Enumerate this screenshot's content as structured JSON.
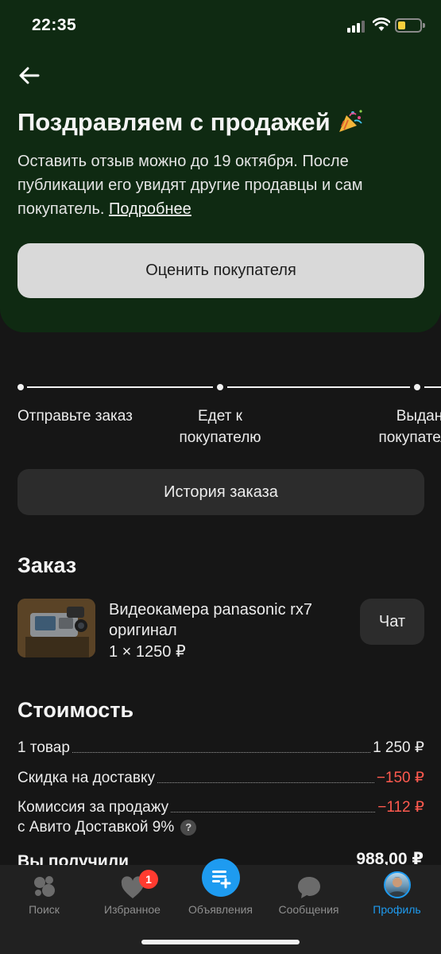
{
  "status_bar": {
    "time": "22:35"
  },
  "hero": {
    "title": "Поздравляем с продажей",
    "description": "Оставить отзыв можно до 19 октября. После публикации его увидят другие продавцы и сам покупатель.",
    "link": "Подробнее",
    "rate_button": "Оценить покупателя"
  },
  "timeline": {
    "steps": [
      {
        "label": "Отправьте заказ"
      },
      {
        "label_line1": "Едет к",
        "label_line2": "покупателю"
      },
      {
        "label_line1": "Выдан",
        "label_line2": "покупателю"
      }
    ]
  },
  "history_button": "История заказа",
  "order": {
    "title": "Заказ",
    "product_name": "Видеокамера panasonic rx7 оригинал",
    "product_qty": "1 × 1250 ₽",
    "chat_button": "Чат"
  },
  "cost": {
    "title": "Стоимость",
    "rows": [
      {
        "label": "1 товар",
        "value": "1 250 ₽"
      },
      {
        "label": "Скидка на доставку",
        "value": "−150 ₽"
      },
      {
        "label": "Комиссия за продажу",
        "value": "−112 ₽"
      }
    ],
    "commission_sub": "с Авито Доставкой 9%",
    "help_icon": "?",
    "received_label": "Вы получили",
    "received_value": "988,00 ₽"
  },
  "tabbar": {
    "tabs": [
      {
        "label": "Поиск",
        "icon": "search-icon"
      },
      {
        "label": "Избранное",
        "icon": "heart-icon",
        "badge": "1"
      },
      {
        "label": "Объявления",
        "icon": "add-listing-icon"
      },
      {
        "label": "Сообщения",
        "icon": "chat-bubble-icon"
      },
      {
        "label": "Профиль",
        "icon": "avatar",
        "active": true
      }
    ]
  },
  "colors": {
    "hero_bg": "#0f2a12",
    "page_bg": "#161616",
    "accent": "#1e9bf0",
    "negative": "#ff5a4f",
    "badge": "#ff3b30"
  }
}
